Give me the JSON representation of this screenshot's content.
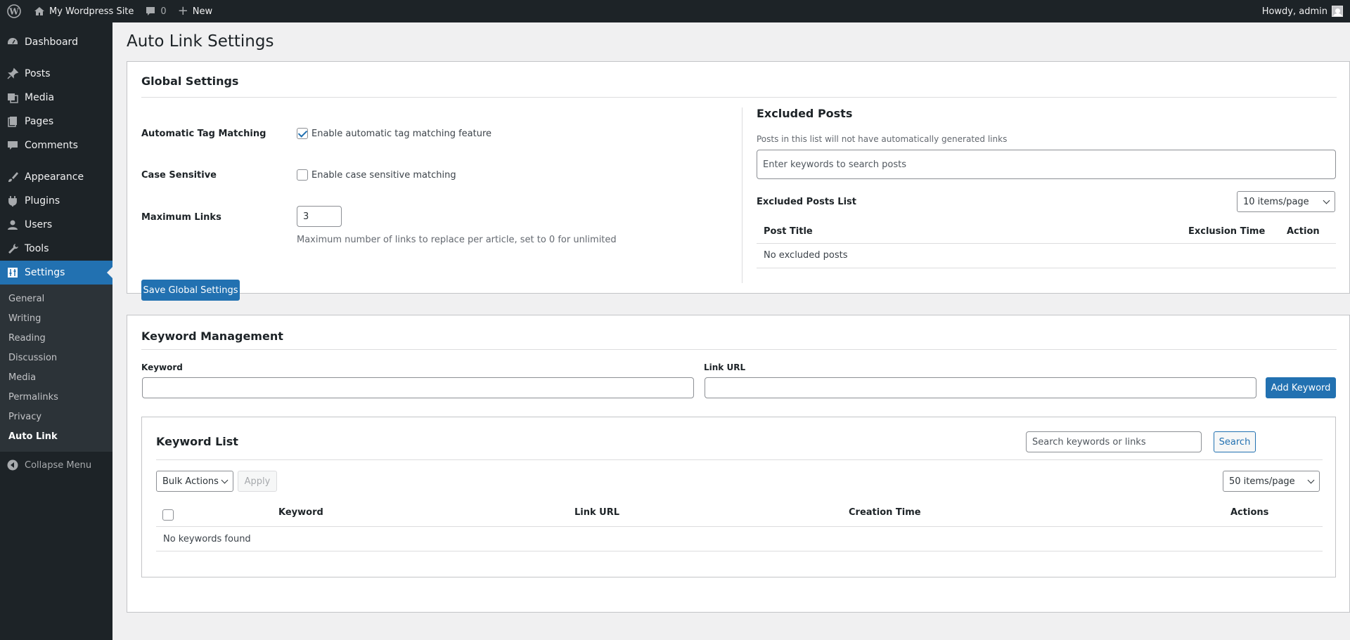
{
  "adminbar": {
    "site_name": "My Wordpress Site",
    "comments_count": "0",
    "new_label": "New",
    "howdy": "Howdy, admin"
  },
  "sidebar": {
    "items": [
      {
        "label": "Dashboard",
        "icon": "dashboard-icon"
      },
      {
        "label": "Posts",
        "icon": "pin-icon"
      },
      {
        "label": "Media",
        "icon": "media-icon"
      },
      {
        "label": "Pages",
        "icon": "pages-icon"
      },
      {
        "label": "Comments",
        "icon": "comment-icon"
      },
      {
        "label": "Appearance",
        "icon": "brush-icon"
      },
      {
        "label": "Plugins",
        "icon": "plugin-icon"
      },
      {
        "label": "Users",
        "icon": "user-icon"
      },
      {
        "label": "Tools",
        "icon": "wrench-icon"
      },
      {
        "label": "Settings",
        "icon": "settings-icon"
      }
    ],
    "submenu": [
      "General",
      "Writing",
      "Reading",
      "Discussion",
      "Media",
      "Permalinks",
      "Privacy",
      "Auto Link"
    ],
    "collapse": "Collapse Menu"
  },
  "page": {
    "title": "Auto Link Settings"
  },
  "global": {
    "title": "Global Settings",
    "tag_matching_label": "Automatic Tag Matching",
    "tag_matching_text": "Enable automatic tag matching feature",
    "tag_matching_checked": true,
    "case_label": "Case Sensitive",
    "case_text": "Enable case sensitive matching",
    "case_checked": false,
    "max_links_label": "Maximum Links",
    "max_links_value": "3",
    "max_links_desc": "Maximum number of links to replace per article, set to 0 for unlimited",
    "save_button": "Save Global Settings"
  },
  "excluded": {
    "title": "Excluded Posts",
    "desc": "Posts in this list will not have automatically generated links",
    "search_placeholder": "Enter keywords to search posts",
    "list_title": "Excluded Posts List",
    "per_page": "10 items/page",
    "col_title": "Post Title",
    "col_time": "Exclusion Time",
    "col_action": "Action",
    "empty": "No excluded posts"
  },
  "keywords": {
    "title": "Keyword Management",
    "keyword_label": "Keyword",
    "url_label": "Link URL",
    "add_button": "Add Keyword",
    "list_title": "Keyword List",
    "search_placeholder": "Search keywords or links",
    "search_button": "Search",
    "bulk_actions": "Bulk Actions",
    "apply": "Apply",
    "per_page": "50 items/page",
    "col_keyword": "Keyword",
    "col_url": "Link URL",
    "col_time": "Creation Time",
    "col_actions": "Actions",
    "empty": "No keywords found"
  },
  "colors": {
    "accent": "#2271b1",
    "sidebar_bg": "#1d2327",
    "page_bg": "#f0f0f1"
  }
}
